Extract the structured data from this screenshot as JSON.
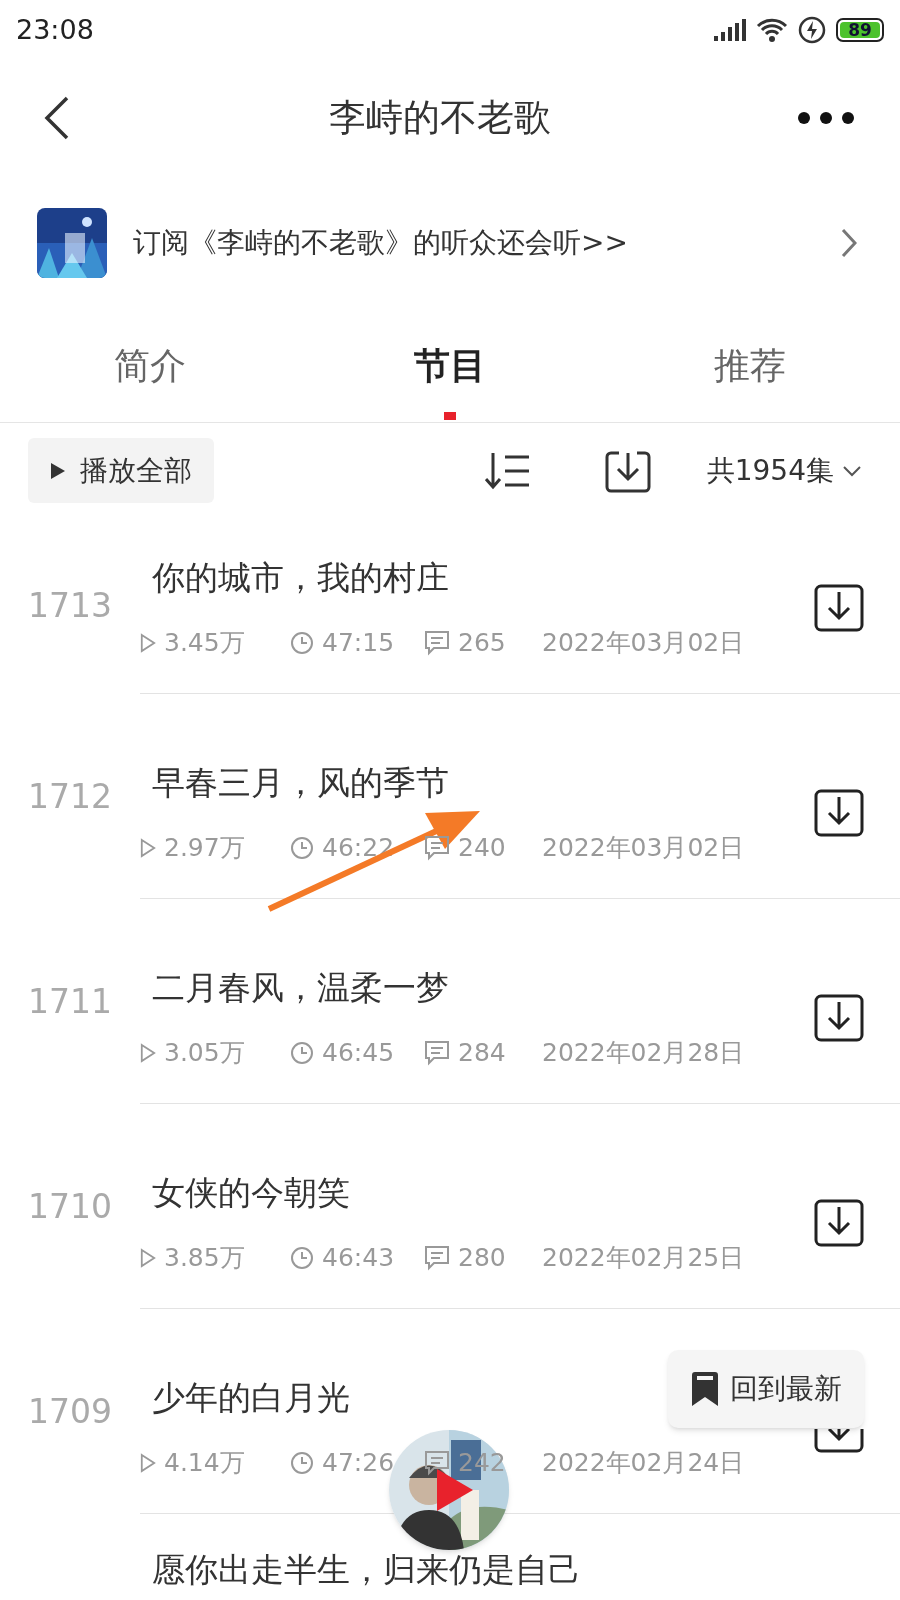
{
  "status_bar": {
    "time": "23:08",
    "battery": "89"
  },
  "header": {
    "title": "李峙的不老歌"
  },
  "banner": {
    "text": "订阅《李峙的不老歌》的听众还会听>>"
  },
  "tabs": [
    {
      "label": "简介",
      "selected": false
    },
    {
      "label": "节目",
      "selected": true
    },
    {
      "label": "推荐",
      "selected": false
    }
  ],
  "toolbar": {
    "play_all": "播放全部",
    "count": "共1954集"
  },
  "episodes": [
    {
      "number": "1713",
      "title": "你的城市，我的村庄",
      "plays": "3.45万",
      "duration": "47:15",
      "comments": "265",
      "date": "2022年03月02日"
    },
    {
      "number": "1712",
      "title": "早春三月，风的季节",
      "plays": "2.97万",
      "duration": "46:22",
      "comments": "240",
      "date": "2022年03月02日"
    },
    {
      "number": "1711",
      "title": "二月春风，温柔一梦",
      "plays": "3.05万",
      "duration": "46:45",
      "comments": "284",
      "date": "2022年02月28日"
    },
    {
      "number": "1710",
      "title": "女侠的今朝笑",
      "plays": "3.85万",
      "duration": "46:43",
      "comments": "280",
      "date": "2022年02月25日"
    },
    {
      "number": "1709",
      "title": "少年的白月光",
      "plays": "4.14万",
      "duration": "47:26",
      "comments": "242",
      "date": "2022年02月24日"
    },
    {
      "title": "愿你出走半生，归来仍是自己"
    }
  ],
  "back_to_latest": "回到最新"
}
